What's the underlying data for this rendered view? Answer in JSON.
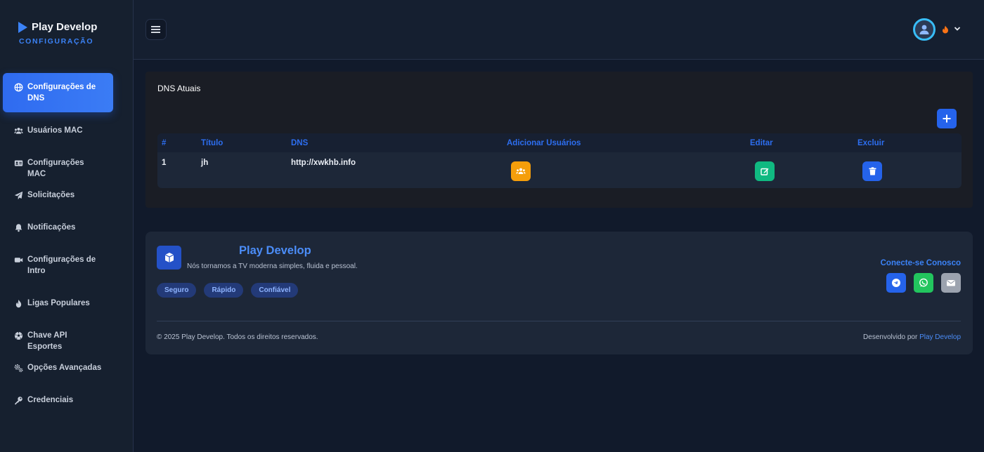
{
  "brand": {
    "title": "Play Develop",
    "subtitle": "CONFIGURAÇÃO"
  },
  "sidebar": {
    "items": [
      {
        "label": "Configurações de DNS",
        "icon": "globe-icon",
        "active": true
      },
      {
        "label": "Usuários MAC",
        "icon": "users-icon"
      },
      {
        "label": "Configurações MAC",
        "icon": "id-card-icon"
      },
      {
        "label": "Solicitações",
        "icon": "paper-plane-icon"
      },
      {
        "label": "Notificações",
        "icon": "bell-icon"
      },
      {
        "label": "Configurações de Intro",
        "icon": "video-icon"
      },
      {
        "label": "Ligas Populares",
        "icon": "fire-icon"
      },
      {
        "label": "Chave API Esportes",
        "icon": "soccer-ball-icon"
      },
      {
        "label": "Opções Avançadas",
        "icon": "gears-icon"
      },
      {
        "label": "Credenciais",
        "icon": "key-icon"
      }
    ]
  },
  "dns_section": {
    "title": "DNS Atuais",
    "columns": [
      "#",
      "Título",
      "DNS",
      "Adicionar Usuários",
      "Editar",
      "Excluir"
    ],
    "rows": [
      {
        "id": "1",
        "title": "jh",
        "dns": "http://xwkhb.info"
      }
    ]
  },
  "footer": {
    "title": "Play Develop",
    "tagline": "Nós tornamos a TV moderna simples, fluida e pessoal.",
    "badges": [
      "Seguro",
      "Rápido",
      "Confiável"
    ],
    "connect_label": "Conecte-se Conosco",
    "copyright": "© 2025 Play Develop. Todos os direitos reservados.",
    "developed_by_label": "Desenvolvido por",
    "developed_by_name": "Play Develop"
  },
  "colors": {
    "accent": "#2563eb",
    "add_users": "#f59e0b",
    "edit": "#10b981",
    "delete": "#2563eb",
    "telegram": "#2563eb",
    "whatsapp": "#22c55e",
    "email": "#9ca3af"
  }
}
